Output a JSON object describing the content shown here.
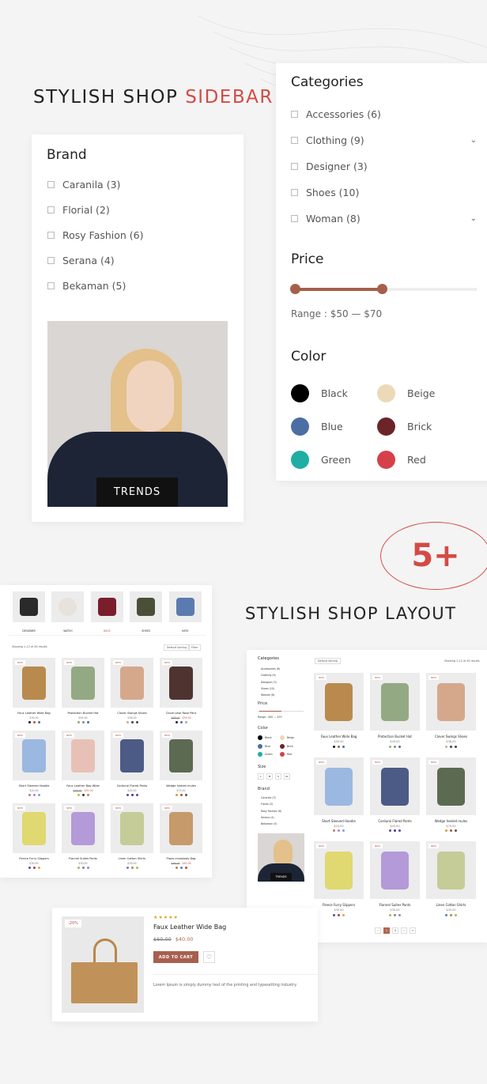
{
  "colors": {
    "accent": "#d44a46",
    "brand": "#b06650",
    "slider": "#a65f4a"
  },
  "headline1": {
    "part1": "STYLISH SHOP",
    "part2": "SIDEBAR"
  },
  "headline2": "STYLISH SHOP LAYOUT",
  "badge_5plus": "5+",
  "brand": {
    "title": "Brand",
    "items": [
      "Caranila (3)",
      "Florial (2)",
      "Rosy Fashion (6)",
      "Serana (4)",
      "Bekaman (5)"
    ],
    "banner_label": "TRENDS"
  },
  "categories": {
    "title": "Categories",
    "items": [
      {
        "label": "Accessories (6)",
        "expand": false
      },
      {
        "label": "Clothing (9)",
        "expand": true
      },
      {
        "label": "Designer (3)",
        "expand": false
      },
      {
        "label": "Shoes (10)",
        "expand": false
      },
      {
        "label": "Woman (8)",
        "expand": true
      }
    ]
  },
  "price": {
    "title": "Price",
    "range_label": "Range : $50 — $70",
    "min": 50,
    "max": 70,
    "from_fraction": 0,
    "to_fraction": 0.48
  },
  "color": {
    "title": "Color",
    "swatches": [
      {
        "name": "Black",
        "hex": "#000000"
      },
      {
        "name": "Beige",
        "hex": "#ecd9b8"
      },
      {
        "name": "Blue",
        "hex": "#4c6ea3"
      },
      {
        "name": "Brick",
        "hex": "#6b2528"
      },
      {
        "name": "Green",
        "hex": "#1faea4"
      },
      {
        "name": "Red",
        "hex": "#d6404a"
      }
    ]
  },
  "grid_layout": {
    "category_tiles": [
      {
        "label": "DESIGNER",
        "img": "#2a2a2a"
      },
      {
        "label": "WATCH",
        "img": "#e8e2dc"
      },
      {
        "label": "BAGS",
        "img": "#7a1e2c",
        "active": true
      },
      {
        "label": "SHOES",
        "img": "#4a5038"
      },
      {
        "label": "HATS",
        "img": "#5b7ab0"
      }
    ],
    "showing": "Showing 1–12 of 45 results",
    "sort": "Default Sorting",
    "filter": "Filter",
    "products": [
      {
        "name": "Faux Leather Wide Bag",
        "price": "$30.00",
        "img": "#b98a4e",
        "dots": [
          "#111",
          "#a65f4a",
          "#4c6ea3"
        ]
      },
      {
        "name": "Protection Bucket Hat",
        "price": "$45.00",
        "img": "#93a983",
        "dots": [
          "#93a983",
          "#888",
          "#4c6ea3"
        ]
      },
      {
        "name": "Clover Swings Shoes",
        "price": "$36.00",
        "img": "#d5a88c",
        "dots": [
          "#d5a88c",
          "#444",
          "#444"
        ]
      },
      {
        "name": "Clove Lese Rose Pant",
        "old": "$46.00",
        "price": "$39.00",
        "img": "#4e3430",
        "dots": [
          "#222",
          "#4c6ea3",
          "#aaa"
        ]
      },
      {
        "name": "Short Sleeved Hoodie",
        "price": "$20.00",
        "img": "#9bb8e0",
        "dots": [
          "#c27a6e",
          "#c47ad0",
          "#7ca0e0"
        ]
      },
      {
        "name": "Faux Leather Bag Wide",
        "old": "$49.00",
        "price": "$35.00",
        "img": "#e8c1b6",
        "dots": [
          "#c8b850",
          "#333",
          "#c27a6e"
        ]
      },
      {
        "name": "Corduroi Flared Pants",
        "price": "$45.00",
        "img": "#4c5a86",
        "dots": [
          "#5a4aa8",
          "#3a3a9a",
          "#4a4ab0"
        ]
      },
      {
        "name": "Wedge heeled mules",
        "price": "$75.00",
        "img": "#5d6a52",
        "dots": [
          "#c8a040",
          "#b05030",
          "#555"
        ]
      },
      {
        "name": "Fleece Furry Slippers",
        "price": "$30.00",
        "img": "#e0d870",
        "dots": [
          "#5a4aa8",
          "#c03a3a",
          "#d0b040"
        ]
      },
      {
        "name": "Flannel Suites Pants",
        "price": "$30.00",
        "img": "#b49ad8",
        "dots": [
          "#b0b060",
          "#888",
          "#a080d0"
        ]
      },
      {
        "name": "Linen Cotton Shirts",
        "price": "$35.00",
        "img": "#c5cc98",
        "dots": [
          "#6080c0",
          "#d08030",
          "#b0b060"
        ]
      },
      {
        "name": "Plaza crossbody Bag",
        "old": "$46.00",
        "price": "$40.00",
        "img": "#c69a6a",
        "dots": [
          "#c08040",
          "#6080c0",
          "#c05030"
        ]
      }
    ]
  },
  "sidebar_layout": {
    "sort": "Default Sorting",
    "showing": "Showing 1–12 of 45 results",
    "categories": [
      "Accessories (6)",
      "Clothing (9)",
      "Designer (3)",
      "Shoes (10)",
      "Woman (8)"
    ],
    "price_title": "Price",
    "range": "Range : $50 — $70",
    "color_title": "Color",
    "colors": [
      "Black",
      "Beige",
      "Blue",
      "Brick",
      "Green",
      "Red"
    ],
    "size_title": "Size",
    "sizes": [
      "L",
      "M",
      "S",
      "XL"
    ],
    "brand_title": "Brand",
    "brands": [
      "Caranila (3)",
      "Florial (2)",
      "Rosy Fashion (6)",
      "Serana (4)",
      "Bekaman (5)"
    ],
    "banner": "TRENDS",
    "products": [
      0,
      1,
      2,
      4,
      6,
      7,
      8,
      9,
      10
    ],
    "pages": [
      "‹",
      "1",
      "2",
      "›",
      "»"
    ],
    "current_page": "1"
  },
  "quickview": {
    "discount": "-20%",
    "rating": 5,
    "stars": "★★★★★",
    "name": "Faux Leather Wide Bag",
    "old_price": "$60.00",
    "price": "$40.00",
    "add_to_cart": "ADD TO CART",
    "description": "Lorem Ipsum is simply dummy text of the printing and typesetting industry."
  },
  "new_badge": "NEW"
}
